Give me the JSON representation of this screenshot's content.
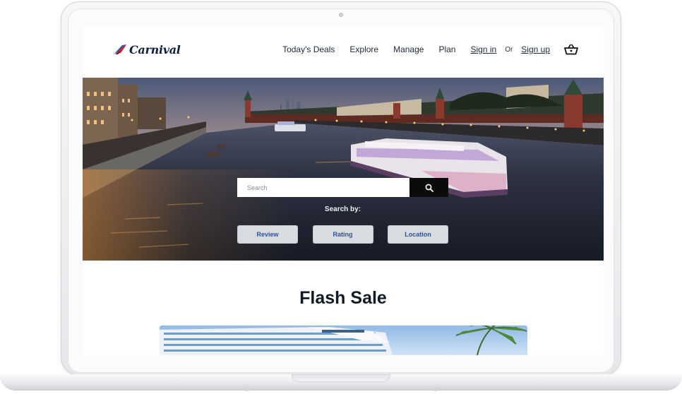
{
  "brand": {
    "logo_text": "Carnival",
    "colors": {
      "navy": "#10213d",
      "red": "#d21f2b",
      "blue": "#1e63b5",
      "link": "#2a5494"
    }
  },
  "header": {
    "nav": [
      {
        "label": "Today's Deals"
      },
      {
        "label": "Explore"
      },
      {
        "label": "Manage"
      },
      {
        "label": "Plan"
      }
    ],
    "sign_in": "Sign in",
    "or_text": "Or",
    "sign_up": "Sign up",
    "cart_icon": "basket-icon"
  },
  "hero": {
    "search_placeholder": "Search",
    "search_icon": "search-icon",
    "search_by_label": "Search by:",
    "filters": [
      {
        "label": "Review"
      },
      {
        "label": "Rating"
      },
      {
        "label": "Location"
      }
    ]
  },
  "sections": {
    "flash_sale_title": "Flash Sale"
  }
}
